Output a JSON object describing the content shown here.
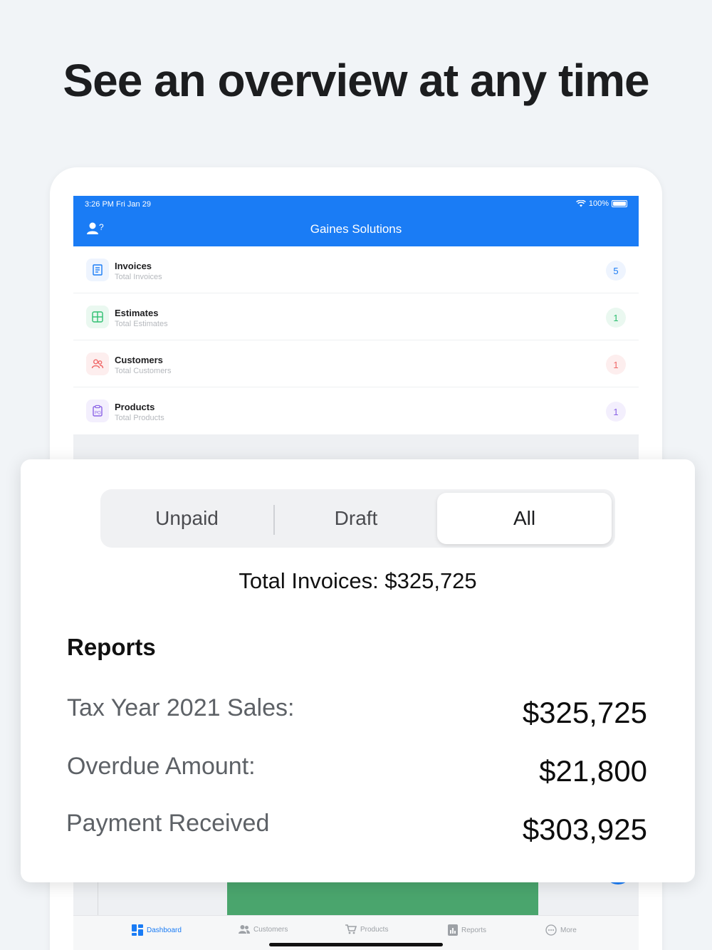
{
  "headline": "See an overview at any time",
  "status_bar": {
    "time": "3:26 PM   Fri Jan 29",
    "battery": "100%"
  },
  "navbar": {
    "title": "Gaines Solutions"
  },
  "dashboard_items": [
    {
      "title": "Invoices",
      "subtitle": "Total Invoices",
      "count": "5",
      "color": "#1a7cf5"
    },
    {
      "title": "Estimates",
      "subtitle": "Total Estimates",
      "count": "1",
      "color": "#2fbf71"
    },
    {
      "title": "Customers",
      "subtitle": "Total Customers",
      "count": "1",
      "color": "#f06969"
    },
    {
      "title": "Products",
      "subtitle": "Total Products",
      "count": "1",
      "color": "#8a62e6"
    }
  ],
  "segmented_control": {
    "options": [
      "Unpaid",
      "Draft",
      "All"
    ],
    "selected": "All"
  },
  "total_invoices": "Total Invoices: $325,725",
  "reports": {
    "title": "Reports",
    "rows": [
      {
        "label": "Tax Year 2021 Sales:",
        "value": "$325,725"
      },
      {
        "label": "Overdue Amount:",
        "value": "$21,800"
      },
      {
        "label": "Payment Received",
        "value": "$303,925"
      }
    ]
  },
  "tabbar": {
    "items": [
      {
        "label": "Dashboard",
        "icon": "dashboard-icon"
      },
      {
        "label": "Customers",
        "icon": "customers-icon"
      },
      {
        "label": "Products",
        "icon": "cart-icon"
      },
      {
        "label": "Reports",
        "icon": "reports-icon"
      },
      {
        "label": "More",
        "icon": "more-icon"
      }
    ],
    "active": "Dashboard"
  }
}
